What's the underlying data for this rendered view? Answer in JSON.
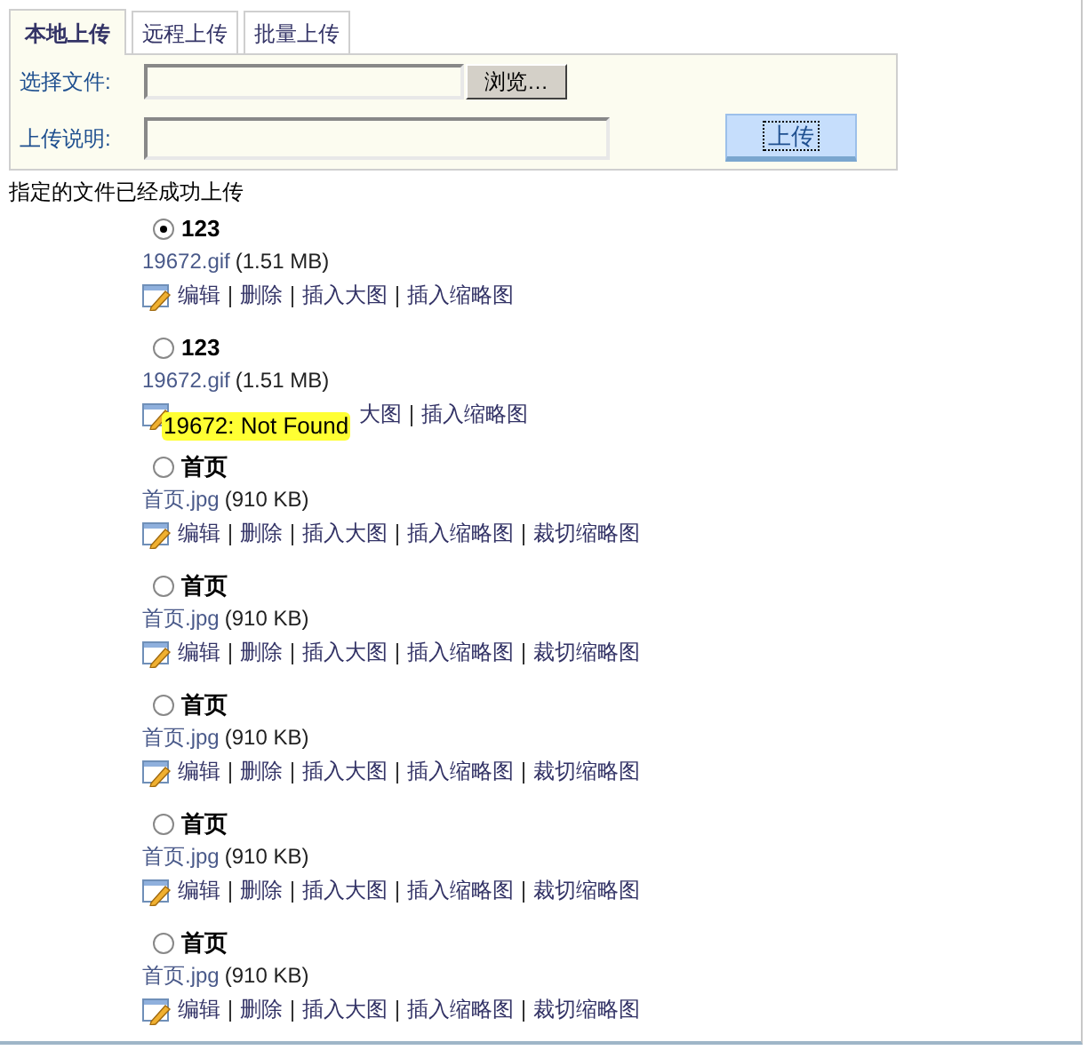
{
  "tabs": [
    {
      "label": "本地上传",
      "selected": true
    },
    {
      "label": "远程上传",
      "selected": false
    },
    {
      "label": "批量上传",
      "selected": false
    }
  ],
  "form": {
    "file_label": "选择文件:",
    "browse_button": "浏览…",
    "desc_label": "上传说明:",
    "upload_button": "上传"
  },
  "message": "指定的文件已经成功上传",
  "files": [
    {
      "title": "123",
      "selected": true,
      "file": "19672.gif",
      "size": "(1.51 MB)",
      "actions": [
        "编辑",
        "删除",
        "插入大图",
        "插入缩略图"
      ]
    },
    {
      "title": "123",
      "selected": false,
      "file": "19672.gif",
      "size": "(1.51 MB)",
      "tooltip": "19672: Not Found",
      "actions": [
        "大图",
        "插入缩略图"
      ]
    },
    {
      "title": "首页",
      "selected": false,
      "file": "首页.jpg",
      "size": "(910 KB)",
      "actions": [
        "编辑",
        "删除",
        "插入大图",
        "插入缩略图",
        "裁切缩略图"
      ]
    },
    {
      "title": "首页",
      "selected": false,
      "file": "首页.jpg",
      "size": "(910 KB)",
      "actions": [
        "编辑",
        "删除",
        "插入大图",
        "插入缩略图",
        "裁切缩略图"
      ]
    },
    {
      "title": "首页",
      "selected": false,
      "file": "首页.jpg",
      "size": "(910 KB)",
      "actions": [
        "编辑",
        "删除",
        "插入大图",
        "插入缩略图",
        "裁切缩略图"
      ]
    },
    {
      "title": "首页",
      "selected": false,
      "file": "首页.jpg",
      "size": "(910 KB)",
      "actions": [
        "编辑",
        "删除",
        "插入大图",
        "插入缩略图",
        "裁切缩略图"
      ]
    },
    {
      "title": "首页",
      "selected": false,
      "file": "首页.jpg",
      "size": "(910 KB)",
      "actions": [
        "编辑",
        "删除",
        "插入大图",
        "插入缩略图",
        "裁切缩略图"
      ]
    }
  ]
}
